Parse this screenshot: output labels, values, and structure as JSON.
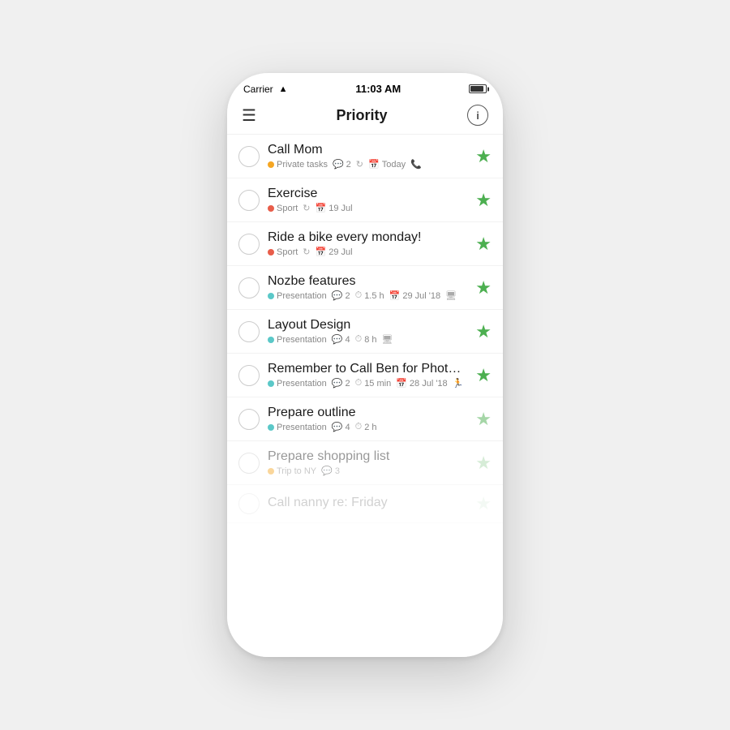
{
  "status": {
    "carrier": "Carrier",
    "wifi": "wifi",
    "time": "11:03 AM",
    "battery": "battery"
  },
  "nav": {
    "title": "Priority",
    "hamburger": "☰",
    "info": "i"
  },
  "tasks": [
    {
      "id": 1,
      "title": "Call Mom",
      "meta": [
        {
          "type": "tag",
          "dot": "orange",
          "label": "Private tasks"
        },
        {
          "type": "icon",
          "icon": "💬",
          "label": "2"
        },
        {
          "type": "icon",
          "icon": "↻",
          "label": ""
        },
        {
          "type": "icon",
          "icon": "📅",
          "label": "Today"
        },
        {
          "type": "icon",
          "icon": "📞",
          "label": ""
        }
      ],
      "star": "full",
      "faded": false
    },
    {
      "id": 2,
      "title": "Exercise",
      "meta": [
        {
          "type": "tag",
          "dot": "red",
          "label": "Sport"
        },
        {
          "type": "icon",
          "icon": "↻",
          "label": ""
        },
        {
          "type": "icon",
          "icon": "📅",
          "label": "19 Jul"
        }
      ],
      "star": "full",
      "faded": false
    },
    {
      "id": 3,
      "title": "Ride a bike every monday!",
      "meta": [
        {
          "type": "tag",
          "dot": "red",
          "label": "Sport"
        },
        {
          "type": "icon",
          "icon": "↻",
          "label": ""
        },
        {
          "type": "icon",
          "icon": "📅",
          "label": "29 Jul"
        }
      ],
      "star": "full",
      "faded": false
    },
    {
      "id": 4,
      "title": "Nozbe features",
      "meta": [
        {
          "type": "tag",
          "dot": "blue",
          "label": "Presentation"
        },
        {
          "type": "icon",
          "icon": "💬",
          "label": "2"
        },
        {
          "type": "icon",
          "icon": "⏱",
          "label": "1.5 h"
        },
        {
          "type": "icon",
          "icon": "📅",
          "label": "29 Jul '18"
        },
        {
          "type": "icon",
          "icon": "🖥",
          "label": ""
        }
      ],
      "star": "full",
      "faded": false
    },
    {
      "id": 5,
      "title": "Layout Design",
      "meta": [
        {
          "type": "tag",
          "dot": "blue",
          "label": "Presentation"
        },
        {
          "type": "icon",
          "icon": "💬",
          "label": "4"
        },
        {
          "type": "icon",
          "icon": "⏱",
          "label": "8 h"
        },
        {
          "type": "icon",
          "icon": "🖥",
          "label": ""
        }
      ],
      "star": "full",
      "faded": false
    },
    {
      "id": 6,
      "title": "Remember to Call Ben for Photos!",
      "meta": [
        {
          "type": "tag",
          "dot": "blue",
          "label": "Presentation"
        },
        {
          "type": "icon",
          "icon": "💬",
          "label": "2"
        },
        {
          "type": "icon",
          "icon": "⏱",
          "label": "15 min"
        },
        {
          "type": "icon",
          "icon": "📅",
          "label": "28 Jul '18"
        },
        {
          "type": "icon",
          "icon": "🏃",
          "label": ""
        }
      ],
      "star": "full",
      "faded": false
    },
    {
      "id": 7,
      "title": "Prepare outline",
      "meta": [
        {
          "type": "tag",
          "dot": "blue",
          "label": "Presentation"
        },
        {
          "type": "icon",
          "icon": "💬",
          "label": "4"
        },
        {
          "type": "icon",
          "icon": "⏱",
          "label": "2 h"
        }
      ],
      "star": "light",
      "faded": false
    },
    {
      "id": 8,
      "title": "Prepare shopping list",
      "meta": [
        {
          "type": "tag",
          "dot": "orange",
          "label": "Trip to NY"
        },
        {
          "type": "icon",
          "icon": "💬",
          "label": "3"
        }
      ],
      "star": "light",
      "faded": true
    },
    {
      "id": 9,
      "title": "Call nanny re: Friday",
      "meta": [],
      "star": "outline",
      "faded": true,
      "very_faded": true
    }
  ]
}
